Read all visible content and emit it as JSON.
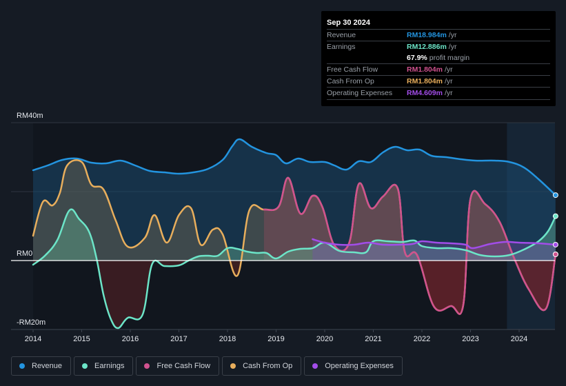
{
  "tooltip": {
    "date": "Sep 30 2024",
    "rows": [
      {
        "label": "Revenue",
        "value": "RM18.984m",
        "unit": "/yr",
        "color": "#2394df"
      },
      {
        "label": "Earnings",
        "value": "RM12.886m",
        "unit": "/yr",
        "color": "#6ce5c8"
      },
      {
        "label": "",
        "value": "67.9%",
        "unit": "profit margin",
        "color": "#ffffff"
      },
      {
        "label": "Free Cash Flow",
        "value": "RM1.804m",
        "unit": "/yr",
        "color": "#d0528f"
      },
      {
        "label": "Cash From Op",
        "value": "RM1.804m",
        "unit": "/yr",
        "color": "#e8ae5c"
      },
      {
        "label": "Operating Expenses",
        "value": "RM4.609m",
        "unit": "/yr",
        "color": "#a24de9"
      }
    ]
  },
  "legend": [
    {
      "label": "Revenue",
      "color": "#2394df"
    },
    {
      "label": "Earnings",
      "color": "#6ce5c8"
    },
    {
      "label": "Free Cash Flow",
      "color": "#d0528f"
    },
    {
      "label": "Cash From Op",
      "color": "#e8ae5c"
    },
    {
      "label": "Operating Expenses",
      "color": "#a24de9"
    }
  ],
  "chart_data": {
    "type": "area",
    "title": "",
    "xlabel": "",
    "ylabel": "",
    "y_unit": "RM m",
    "ylim": [
      -20,
      40
    ],
    "xlim": [
      2014,
      2024.75
    ],
    "y_tick_labels": [
      {
        "value": 40,
        "label": "RM40m"
      },
      {
        "value": 0,
        "label": "RM0"
      },
      {
        "value": -20,
        "label": "-RM20m"
      }
    ],
    "x_ticks": [
      2014,
      2015,
      2016,
      2017,
      2018,
      2019,
      2020,
      2021,
      2022,
      2023,
      2024
    ],
    "x_tick_labels": [
      "2014",
      "2015",
      "2016",
      "2017",
      "2018",
      "2019",
      "2020",
      "2021",
      "2022",
      "2023",
      "2024"
    ],
    "forecast_shade_from": 2023.75,
    "grid": true,
    "legend_position": "bottom",
    "series": [
      {
        "name": "Revenue",
        "color": "#2394df",
        "points": [
          [
            2014.0,
            26.2
          ],
          [
            2014.3,
            27.6
          ],
          [
            2014.6,
            29.2
          ],
          [
            2014.9,
            29.6
          ],
          [
            2015.2,
            28.4
          ],
          [
            2015.5,
            28.2
          ],
          [
            2015.8,
            29.0
          ],
          [
            2016.1,
            27.6
          ],
          [
            2016.4,
            26.0
          ],
          [
            2016.7,
            25.6
          ],
          [
            2017.0,
            25.2
          ],
          [
            2017.3,
            25.6
          ],
          [
            2017.6,
            26.6
          ],
          [
            2017.9,
            29.2
          ],
          [
            2018.1,
            33.2
          ],
          [
            2018.25,
            35.2
          ],
          [
            2018.5,
            33.0
          ],
          [
            2018.8,
            31.2
          ],
          [
            2019.0,
            30.6
          ],
          [
            2019.2,
            28.2
          ],
          [
            2019.45,
            29.6
          ],
          [
            2019.7,
            28.6
          ],
          [
            2020.0,
            28.6
          ],
          [
            2020.2,
            27.6
          ],
          [
            2020.45,
            26.4
          ],
          [
            2020.7,
            28.8
          ],
          [
            2020.95,
            28.6
          ],
          [
            2021.2,
            31.4
          ],
          [
            2021.45,
            33.0
          ],
          [
            2021.7,
            32.0
          ],
          [
            2021.95,
            32.2
          ],
          [
            2022.2,
            30.4
          ],
          [
            2022.5,
            30.0
          ],
          [
            2022.8,
            29.4
          ],
          [
            2023.1,
            29.0
          ],
          [
            2023.5,
            29.0
          ],
          [
            2023.8,
            28.6
          ],
          [
            2024.1,
            27.0
          ],
          [
            2024.4,
            23.6
          ],
          [
            2024.75,
            18.984
          ]
        ]
      },
      {
        "name": "Earnings",
        "color": "#6ce5c8",
        "points": [
          [
            2014.0,
            -1.2
          ],
          [
            2014.25,
            1.5
          ],
          [
            2014.5,
            6.0
          ],
          [
            2014.75,
            14.6
          ],
          [
            2014.95,
            12.0
          ],
          [
            2015.15,
            8.4
          ],
          [
            2015.3,
            1.0
          ],
          [
            2015.45,
            -10.0
          ],
          [
            2015.6,
            -17.0
          ],
          [
            2015.75,
            -19.6
          ],
          [
            2015.95,
            -16.6
          ],
          [
            2016.25,
            -15.8
          ],
          [
            2016.45,
            -1.0
          ],
          [
            2016.7,
            -1.6
          ],
          [
            2017.0,
            -1.4
          ],
          [
            2017.2,
            0.0
          ],
          [
            2017.4,
            1.2
          ],
          [
            2017.6,
            1.4
          ],
          [
            2017.8,
            1.4
          ],
          [
            2018.0,
            3.6
          ],
          [
            2018.2,
            3.4
          ],
          [
            2018.4,
            2.6
          ],
          [
            2018.6,
            2.2
          ],
          [
            2018.8,
            2.2
          ],
          [
            2019.0,
            0.6
          ],
          [
            2019.25,
            2.6
          ],
          [
            2019.5,
            3.4
          ],
          [
            2019.75,
            3.6
          ],
          [
            2020.0,
            5.2
          ],
          [
            2020.3,
            2.8
          ],
          [
            2020.6,
            2.4
          ],
          [
            2020.85,
            2.4
          ],
          [
            2021.0,
            5.6
          ],
          [
            2021.3,
            5.6
          ],
          [
            2021.6,
            5.4
          ],
          [
            2021.85,
            5.8
          ],
          [
            2022.0,
            4.2
          ],
          [
            2022.3,
            3.6
          ],
          [
            2022.6,
            3.6
          ],
          [
            2022.9,
            3.0
          ],
          [
            2023.2,
            1.6
          ],
          [
            2023.5,
            1.2
          ],
          [
            2023.8,
            1.6
          ],
          [
            2024.1,
            3.2
          ],
          [
            2024.4,
            5.6
          ],
          [
            2024.6,
            8.6
          ],
          [
            2024.75,
            12.886
          ]
        ]
      },
      {
        "name": "Free Cash Flow",
        "color": "#d0528f",
        "points": [
          [
            2018.75,
            14.8
          ],
          [
            2019.05,
            15.6
          ],
          [
            2019.25,
            24.0
          ],
          [
            2019.5,
            13.6
          ],
          [
            2019.75,
            18.8
          ],
          [
            2019.95,
            15.6
          ],
          [
            2020.2,
            4.4
          ],
          [
            2020.5,
            5.0
          ],
          [
            2020.7,
            22.2
          ],
          [
            2020.95,
            15.2
          ],
          [
            2021.2,
            18.6
          ],
          [
            2021.5,
            21.0
          ],
          [
            2021.65,
            2.4
          ],
          [
            2021.9,
            1.6
          ],
          [
            2022.25,
            -13.4
          ],
          [
            2022.6,
            -13.2
          ],
          [
            2022.85,
            -13.0
          ],
          [
            2023.0,
            18.0
          ],
          [
            2023.3,
            16.4
          ],
          [
            2023.6,
            11.2
          ],
          [
            2023.9,
            0.6
          ],
          [
            2024.2,
            -8.4
          ],
          [
            2024.55,
            -14.0
          ],
          [
            2024.75,
            1.804
          ]
        ]
      },
      {
        "name": "Cash From Op",
        "color": "#e8ae5c",
        "points": [
          [
            2014.0,
            7.2
          ],
          [
            2014.2,
            17.0
          ],
          [
            2014.4,
            16.0
          ],
          [
            2014.55,
            19.6
          ],
          [
            2014.7,
            27.6
          ],
          [
            2015.0,
            28.6
          ],
          [
            2015.2,
            22.0
          ],
          [
            2015.45,
            20.6
          ],
          [
            2015.7,
            11.6
          ],
          [
            2015.95,
            4.0
          ],
          [
            2016.3,
            6.6
          ],
          [
            2016.5,
            13.2
          ],
          [
            2016.75,
            5.2
          ],
          [
            2017.0,
            13.2
          ],
          [
            2017.25,
            15.2
          ],
          [
            2017.45,
            4.6
          ],
          [
            2017.7,
            9.0
          ],
          [
            2017.9,
            7.6
          ],
          [
            2018.2,
            -4.4
          ],
          [
            2018.45,
            14.6
          ],
          [
            2018.75,
            14.8
          ],
          [
            2019.05,
            15.6
          ],
          [
            2019.25,
            24.0
          ],
          [
            2019.5,
            13.6
          ],
          [
            2019.75,
            18.8
          ],
          [
            2019.95,
            15.6
          ],
          [
            2020.2,
            4.4
          ],
          [
            2020.5,
            5.0
          ],
          [
            2020.7,
            22.2
          ],
          [
            2020.95,
            15.2
          ],
          [
            2021.2,
            18.6
          ],
          [
            2021.5,
            21.0
          ],
          [
            2021.65,
            2.4
          ],
          [
            2021.9,
            1.6
          ],
          [
            2022.25,
            -13.4
          ],
          [
            2022.6,
            -13.2
          ],
          [
            2022.85,
            -13.0
          ],
          [
            2023.0,
            18.0
          ],
          [
            2023.3,
            16.4
          ],
          [
            2023.6,
            11.2
          ],
          [
            2023.9,
            0.6
          ],
          [
            2024.2,
            -8.4
          ],
          [
            2024.55,
            -14.0
          ],
          [
            2024.75,
            1.804
          ]
        ]
      },
      {
        "name": "Operating Expenses",
        "color": "#a24de9",
        "points": [
          [
            2019.75,
            6.2
          ],
          [
            2020.0,
            5.2
          ],
          [
            2020.3,
            4.6
          ],
          [
            2020.6,
            4.6
          ],
          [
            2020.9,
            5.2
          ],
          [
            2021.2,
            4.6
          ],
          [
            2021.5,
            4.6
          ],
          [
            2021.8,
            4.8
          ],
          [
            2022.0,
            5.6
          ],
          [
            2022.3,
            5.2
          ],
          [
            2022.6,
            5.0
          ],
          [
            2022.9,
            4.6
          ],
          [
            2023.05,
            3.6
          ],
          [
            2023.4,
            4.8
          ],
          [
            2023.7,
            5.4
          ],
          [
            2024.0,
            5.2
          ],
          [
            2024.4,
            5.0
          ],
          [
            2024.75,
            4.609
          ]
        ]
      }
    ]
  }
}
